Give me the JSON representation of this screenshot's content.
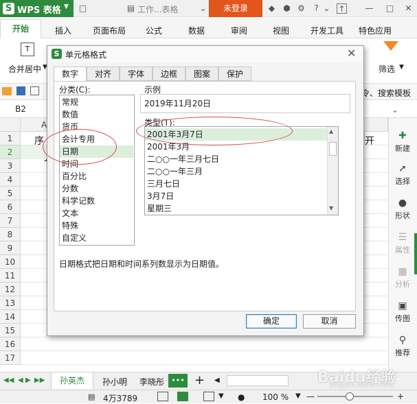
{
  "app": {
    "name": "WPS 表格",
    "doc_title": "工作...表格",
    "login": "未登录"
  },
  "ribbon": {
    "tabs": [
      "开始",
      "插入",
      "页面布局",
      "公式",
      "数据",
      "审阅",
      "视图",
      "开发工具",
      "特色应用"
    ],
    "merge_label": "合并居中",
    "filter_label": "筛选",
    "search_template": "令、搜索模板"
  },
  "formula": {
    "cell_ref": "B2"
  },
  "grid": {
    "col_a": "A",
    "col_a_text": "序",
    "row2_val": "1",
    "right_text": "开",
    "rows": [
      "1",
      "2",
      "3",
      "4",
      "5",
      "6",
      "7",
      "8",
      "9",
      "10",
      "11",
      "12",
      "13",
      "14",
      "15",
      "16",
      "17"
    ]
  },
  "sidebar": {
    "items": [
      "新建",
      "选择",
      "形状",
      "属性",
      "分析",
      "传图",
      "推荐"
    ]
  },
  "sheets": {
    "tabs": [
      "孙英杰",
      "孙小明",
      "李晓彤"
    ],
    "more": "•••",
    "add": "+"
  },
  "status": {
    "count": "4万3789",
    "zoom": "100 %"
  },
  "dialog": {
    "title": "单元格格式",
    "tabs": [
      "数字",
      "对齐",
      "字体",
      "边框",
      "图案",
      "保护"
    ],
    "category_label": "分类(C):",
    "categories": [
      "常规",
      "数值",
      "货币",
      "会计专用",
      "日期",
      "时间",
      "百分比",
      "分数",
      "科学记数",
      "文本",
      "特殊",
      "自定义"
    ],
    "sample_label": "示例",
    "sample_value": "2019年11月20日",
    "type_label": "类型(T):",
    "types": [
      "2001年3月7日",
      "2001年3月",
      "二○○一年三月七日",
      "二○○一年三月",
      "三月七日",
      "3月7日",
      "星期三"
    ],
    "description": "日期格式把日期和时间系列数显示为日期值。",
    "ok": "确定",
    "cancel": "取消"
  },
  "watermark": {
    "text": "Baidu经验",
    "sub": "jingyan.baidu.com"
  },
  "colors": {
    "brand_green": "#2e8b3e",
    "login_orange": "#e2551d",
    "selection_green": "#dceedc",
    "annotation_red": "#e04848"
  }
}
